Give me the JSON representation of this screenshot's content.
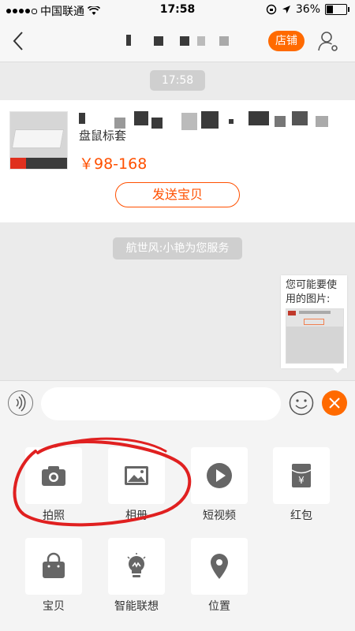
{
  "status_bar": {
    "carrier": "中国联通",
    "time": "17:58",
    "battery": "36%",
    "battery_level": 0.36
  },
  "nav": {
    "shop_button": "店铺"
  },
  "chat": {
    "time_label": "17:58",
    "product": {
      "title": "盘鼠标套",
      "price": "￥98-168",
      "send_button": "发送宝贝"
    },
    "service_notice": "航世风:小艳为您服务",
    "suggest_image_text": "您可能要使用的图片:"
  },
  "input": {
    "placeholder": ""
  },
  "tools": [
    {
      "label": "拍照",
      "icon": "camera-icon"
    },
    {
      "label": "相册",
      "icon": "album-icon"
    },
    {
      "label": "短视频",
      "icon": "video-play-icon"
    },
    {
      "label": "红包",
      "icon": "red-packet-icon"
    },
    {
      "label": "宝贝",
      "icon": "shopping-bag-icon"
    },
    {
      "label": "智能联想",
      "icon": "lightbulb-icon"
    },
    {
      "label": "位置",
      "icon": "location-pin-icon"
    }
  ],
  "colors": {
    "accent": "#ff6a00",
    "price": "#ff5000",
    "annotation": "#e02020"
  }
}
